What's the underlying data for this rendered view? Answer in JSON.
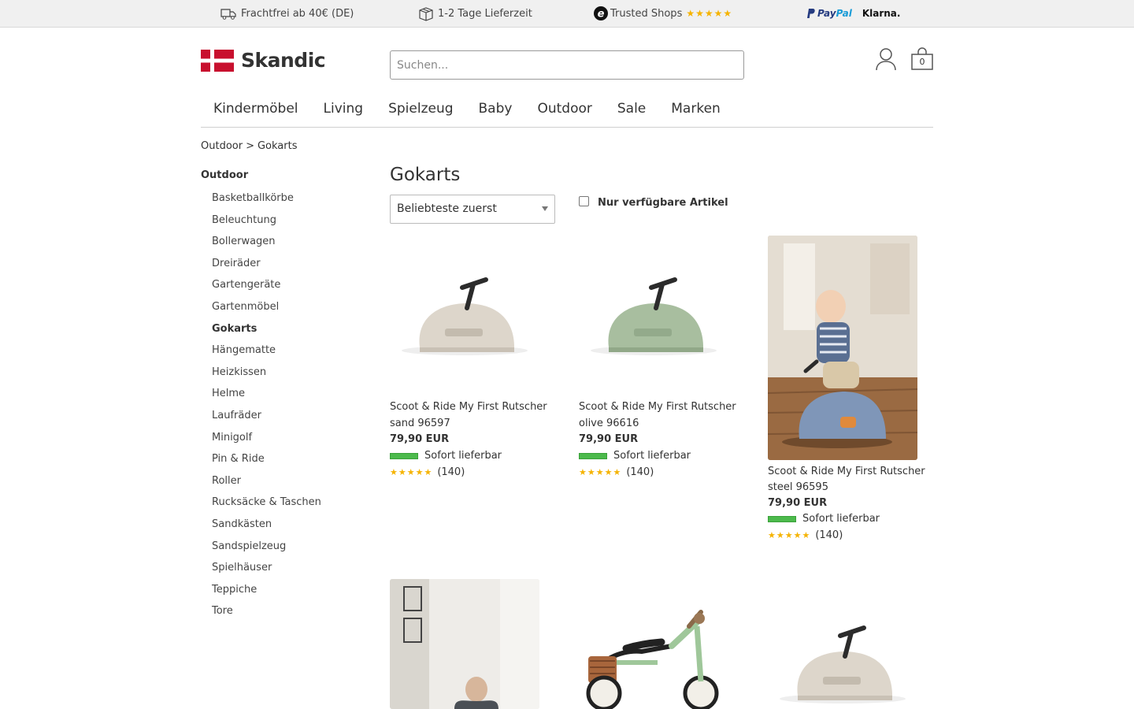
{
  "topbar": {
    "shipping": "Frachtfrei ab 40€ (DE)",
    "delivery": "1-2 Tage Lieferzeit",
    "trusted": "Trusted Shops",
    "trusted_stars": "★★★★★",
    "paypal_pay": "Pay",
    "paypal_pal": "Pal",
    "klarna": "Klarna."
  },
  "header": {
    "logo": "Skandic",
    "search_placeholder": "Suchen...",
    "cart_count": "0"
  },
  "nav": [
    "Kindermöbel",
    "Living",
    "Spielzeug",
    "Baby",
    "Outdoor",
    "Sale",
    "Marken"
  ],
  "breadcrumb": {
    "parent": "Outdoor",
    "separator": ">",
    "current": "Gokarts"
  },
  "sidebar": {
    "heading": "Outdoor",
    "items": [
      "Basketballkörbe",
      "Beleuchtung",
      "Bollerwagen",
      "Dreiräder",
      "Gartengeräte",
      "Gartenmöbel",
      "Gokarts",
      "Hängematte",
      "Heizkissen",
      "Helme",
      "Laufräder",
      "Minigolf",
      "Pin & Ride",
      "Roller",
      "Rucksäcke & Taschen",
      "Sandkästen",
      "Sandspielzeug",
      "Spielhäuser",
      "Teppiche",
      "Tore"
    ],
    "active": "Gokarts"
  },
  "main": {
    "title": "Gokarts",
    "sort_value": "Beliebteste zuerst",
    "filter_label": "Nur verfügbare Artikel"
  },
  "products": [
    {
      "name": "Scoot & Ride My First Rutscher sand 96597",
      "price": "79,90 EUR",
      "stock": "Sofort lieferbar",
      "stars": "★★★★★",
      "reviews": "(140)",
      "color": "#d8d0c4"
    },
    {
      "name": "Scoot & Ride My First Rutscher olive 96616",
      "price": "79,90 EUR",
      "stock": "Sofort lieferbar",
      "stars": "★★★★★",
      "reviews": "(140)",
      "color": "#a9bfa0"
    },
    {
      "name": "Scoot & Ride My First Rutscher steel 96595",
      "price": "79,90 EUR",
      "stock": "Sofort lieferbar",
      "stars": "★★★★★",
      "reviews": "(140)",
      "color": "#7f96b8"
    }
  ],
  "colors": {
    "stock_green": "#4cba4c",
    "star": "#f5b301",
    "flag_red": "#c8102e"
  }
}
